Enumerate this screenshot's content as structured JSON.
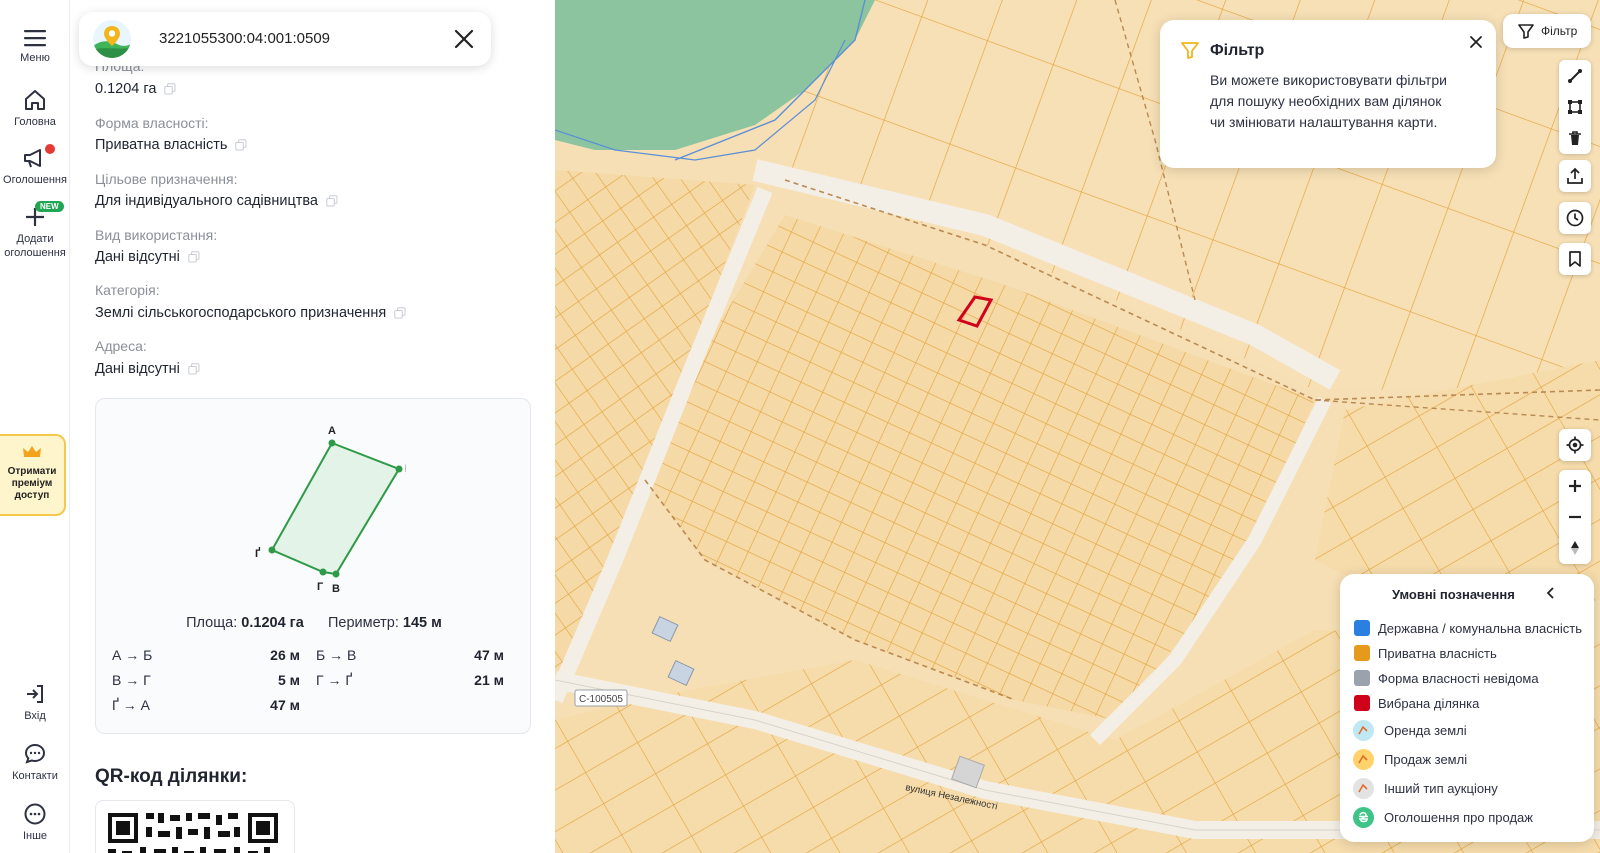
{
  "nav": {
    "menu": "Меню",
    "home": "Головна",
    "ads": "Оголошення",
    "add_line1": "Додати",
    "add_line2": "оголошення",
    "new_badge": "NEW",
    "premium": [
      "Отримати",
      "преміум",
      "доступ"
    ],
    "login": "Вхід",
    "contacts": "Контакти",
    "other": "Інше"
  },
  "search": {
    "value": "3221055300:04:001:0509"
  },
  "fields": [
    {
      "label": "Площа:",
      "value": "0.1204 га"
    },
    {
      "label": "Форма власності:",
      "value": "Приватна власність"
    },
    {
      "label": "Цільове призначення:",
      "value": "Для індивідуального садівництва"
    },
    {
      "label": "Вид використання:",
      "value": "Дані відсутні"
    },
    {
      "label": "Категорія:",
      "value": "Землі сільськогосподарського призначення"
    },
    {
      "label": "Адреса:",
      "value": "Дані відсутні"
    }
  ],
  "geometry": {
    "vertices": [
      "А",
      "Б",
      "В",
      "Г",
      "Ґ"
    ],
    "area_label": "Площа:",
    "area_value": "0.1204 га",
    "perimeter_label": "Периметр:",
    "perimeter_value": "145 м",
    "segments": [
      {
        "name": "А → Б",
        "length": "26 м"
      },
      {
        "name": "Б → В",
        "length": "47 м"
      },
      {
        "name": "В → Г",
        "length": "5 м"
      },
      {
        "name": "Г → Ґ",
        "length": "21 м"
      },
      {
        "name": "Ґ → А",
        "length": "47 м"
      }
    ]
  },
  "qr": {
    "title": "QR-код ділянки:"
  },
  "map": {
    "road_label": "С-100505",
    "street_label": "вулиця Незалежності",
    "colors": {
      "land": "#f6dfb4",
      "parcel_line": "#e2a23a",
      "forest": "#8cc49f",
      "selected": "#d0021b",
      "road": "#f4f1ea"
    }
  },
  "filter": {
    "button": "Фільтр"
  },
  "tip": {
    "title": "Фільтр",
    "text": "Ви можете використовувати фільтри для пошуку необхідних вам ділянок чи змінювати налаштування карти."
  },
  "legend": {
    "title": "Умовні позначення",
    "items": [
      {
        "label": "Державна / комунальна власність",
        "color": "#2b7fe0"
      },
      {
        "label": "Приватна власність",
        "color": "#e59a1c"
      },
      {
        "label": "Форма власності невідома",
        "color": "#9aa3ad"
      },
      {
        "label": "Вибрана ділянка",
        "color": "#d0021b"
      },
      {
        "label": "Оренда землі",
        "color": "#bfe8f3",
        "icon": "land-rent-icon"
      },
      {
        "label": "Продаж землі",
        "color": "#ffd26b",
        "icon": "land-sale-icon"
      },
      {
        "label": "Інший тип аукціону",
        "color": "#e3e3e3",
        "icon": "auction-other-icon"
      },
      {
        "label": "Оголошення про продаж",
        "color": "#3dc486",
        "icon": "hryvnia-icon"
      }
    ]
  }
}
